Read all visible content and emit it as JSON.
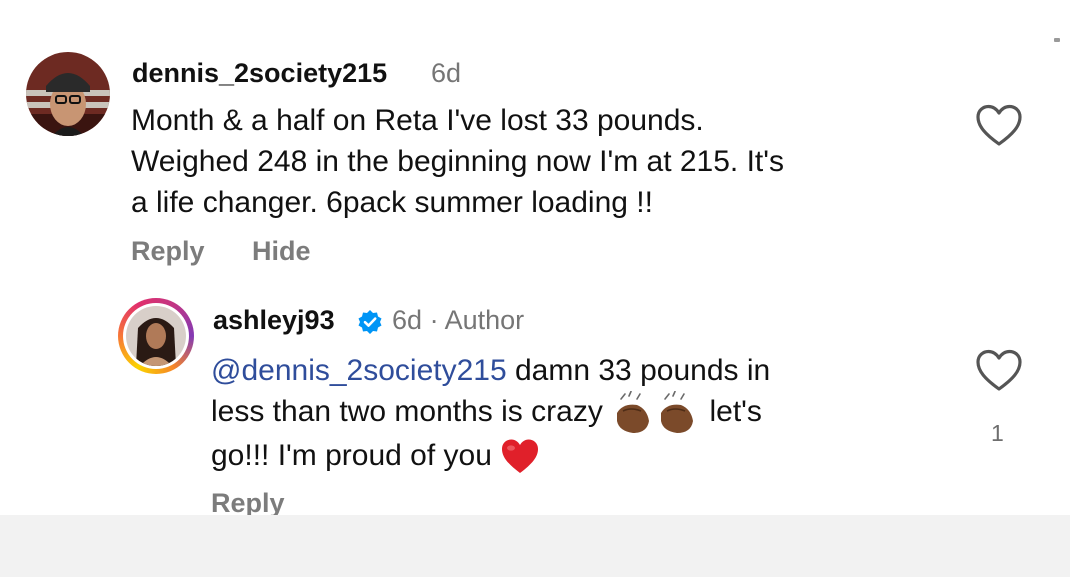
{
  "comments": [
    {
      "username": "dennis_2society215",
      "time": "6d",
      "lines": [
        "Month & a half on Reta I've lost 33 pounds.",
        "Weighed 248 in the beginning now I'm at 215. It's",
        "a life changer. 6pack summer loading !!"
      ],
      "actions": {
        "reply": "Reply",
        "hide": "Hide"
      },
      "like_icon": "heart-outline-icon"
    },
    {
      "username": "ashleyj93",
      "verified_icon": "verified-badge-icon",
      "time": "6d",
      "separator": "·",
      "role": "Author",
      "mention": "@dennis_2society215",
      "line1_rest": " damn 33 pounds in",
      "line2": "less than two months is crazy ",
      "emojis": [
        "clapping-hands-medium-dark-skin",
        "clapping-hands-medium-dark-skin",
        "red-heart"
      ],
      "line2_end": " let's",
      "line3": "go!!! I'm proud of you ",
      "actions": {
        "reply": "Reply"
      },
      "like_icon": "heart-outline-icon",
      "like_count": "1"
    }
  ],
  "colors": {
    "text": "#111111",
    "meta": "#767676",
    "mention": "#2f4d9b",
    "action": "#7c7c7c",
    "heart_emoji": "#e0202a"
  }
}
